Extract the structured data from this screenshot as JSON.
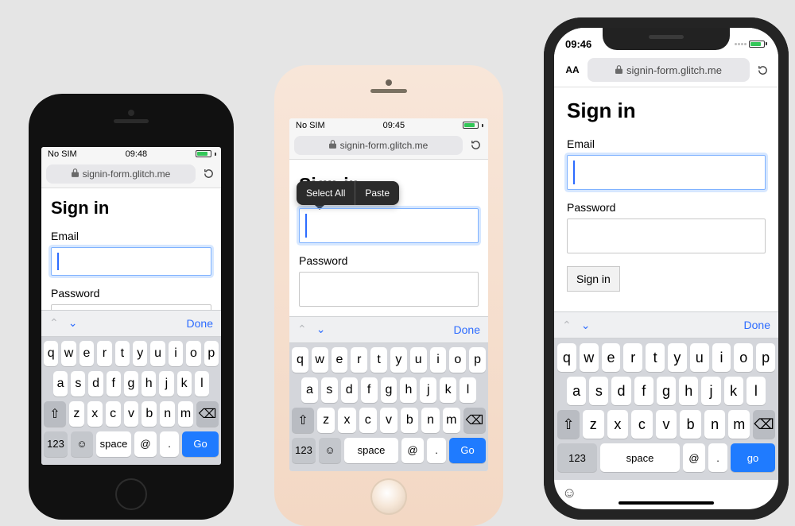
{
  "status": {
    "carrier_nosim": "No SIM",
    "time_p1": "09:48",
    "time_p2": "09:45",
    "time_p3": "09:46"
  },
  "urlbar": {
    "host": "signin-form.glitch.me",
    "aa": "AA"
  },
  "form": {
    "heading": "Sign in",
    "email_label": "Email",
    "password_label": "Password",
    "submit_label": "Sign in"
  },
  "ctx": {
    "select_all": "Select All",
    "paste": "Paste"
  },
  "kbacc": {
    "done": "Done"
  },
  "kb": {
    "row1": [
      "q",
      "w",
      "e",
      "r",
      "t",
      "y",
      "u",
      "i",
      "o",
      "p"
    ],
    "row2": [
      "a",
      "s",
      "d",
      "f",
      "g",
      "h",
      "j",
      "k",
      "l"
    ],
    "row3": [
      "z",
      "x",
      "c",
      "v",
      "b",
      "n",
      "m"
    ],
    "k123": "123",
    "space": "space",
    "at": "@",
    "dot": ".",
    "go": "Go",
    "go_lc": "go"
  }
}
